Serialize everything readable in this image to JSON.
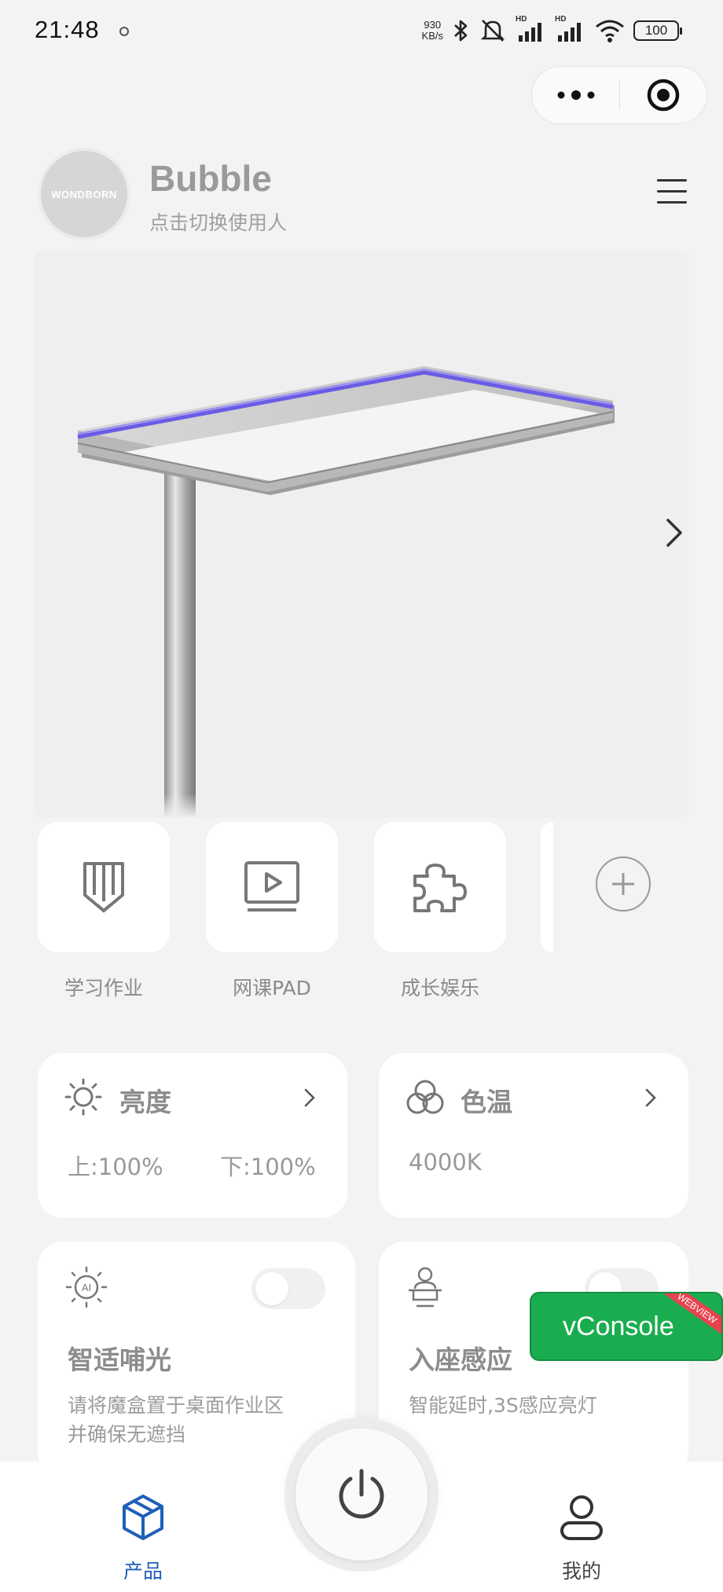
{
  "status_bar": {
    "time": "21:48",
    "net_speed_value": "930",
    "net_speed_unit": "KB/s",
    "signal1_label": "HD",
    "signal2_label": "HD",
    "battery": "100",
    "icons": [
      "bluetooth-icon",
      "mute-icon",
      "signal-icon",
      "signal-icon",
      "wifi-icon",
      "battery-icon"
    ]
  },
  "capsule": {
    "icons": [
      "more-dots-icon",
      "target-close-icon"
    ]
  },
  "profile": {
    "avatar_text": "WONDBORN",
    "name": "Bubble",
    "subtitle": "点击切换使用人"
  },
  "modes": [
    {
      "label": "学习作业",
      "icon": "pencil-icon"
    },
    {
      "label": "网课PAD",
      "icon": "video-play-icon"
    },
    {
      "label": "成长娱乐",
      "icon": "puzzle-icon"
    }
  ],
  "brightness": {
    "title": "亮度",
    "upper": "上:100%",
    "lower": "下:100%",
    "icon": "sun-icon"
  },
  "color_temp": {
    "title": "色温",
    "value": "4000K",
    "icon": "color-circles-icon"
  },
  "smart_light": {
    "title": "智适哺光",
    "desc_line1": "请将魔盒置于桌面作业区",
    "desc_line2": "并确保无遮挡",
    "icon": "ai-sun-icon",
    "enabled": false
  },
  "seat_sense": {
    "title": "入座感应",
    "desc": "智能延时,3S感应亮灯",
    "icon": "person-desk-icon",
    "enabled": false
  },
  "vconsole": {
    "label": "vConsole",
    "tag": "WEBVIEW"
  },
  "tabbar": {
    "product_label": "产品",
    "mine_label": "我的",
    "active_color": "#1e5fb8"
  }
}
